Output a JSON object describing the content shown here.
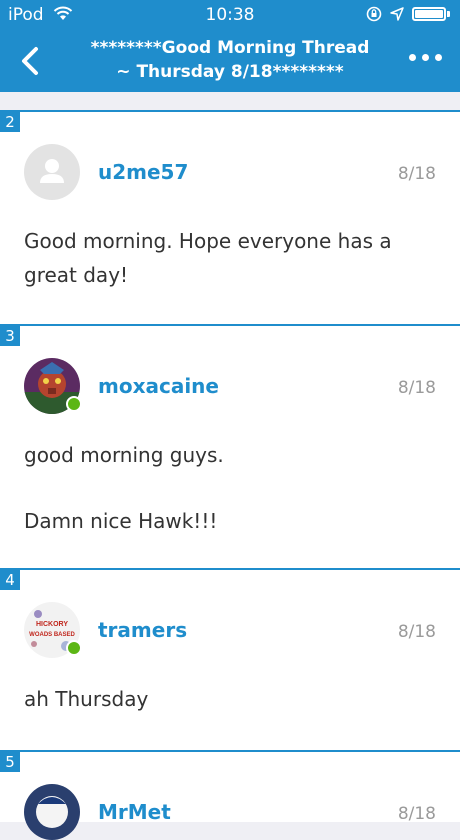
{
  "status_bar": {
    "carrier": "iPod",
    "time": "10:38"
  },
  "nav": {
    "title_line1": "********Good Morning Thread",
    "title_line2": "~ Thursday 8/18********"
  },
  "posts": [
    {
      "number": "2",
      "username": "u2me57",
      "date": "8/18",
      "lines": [
        "Good morning. Hope everyone has a great day!"
      ]
    },
    {
      "number": "3",
      "username": "moxacaine",
      "date": "8/18",
      "lines": [
        "good morning guys.",
        "Damn nice Hawk!!!"
      ]
    },
    {
      "number": "4",
      "username": "tramers",
      "date": "8/18",
      "lines": [
        "ah Thursday"
      ],
      "avatar_text_1": "HICKORY",
      "avatar_text_2": "WOADS BASED"
    },
    {
      "number": "5",
      "username": "MrMet",
      "date": "8/18",
      "lines": []
    }
  ],
  "colors": {
    "accent": "#1f8dcc",
    "online": "#5cb615"
  }
}
